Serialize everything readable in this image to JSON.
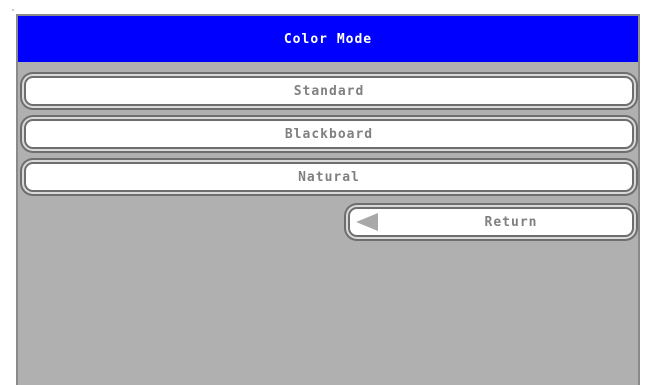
{
  "menu": {
    "title": "Color Mode",
    "options": [
      {
        "label": "Standard"
      },
      {
        "label": "Blackboard"
      },
      {
        "label": "Natural"
      }
    ],
    "return_label": "Return",
    "return_icon": "left-arrow-icon"
  },
  "colors": {
    "title_bar": "#0000ff",
    "title_text": "#ffffff",
    "panel_background": "#b0b0b0",
    "button_background": "#ffffff",
    "button_text": "#808080"
  }
}
